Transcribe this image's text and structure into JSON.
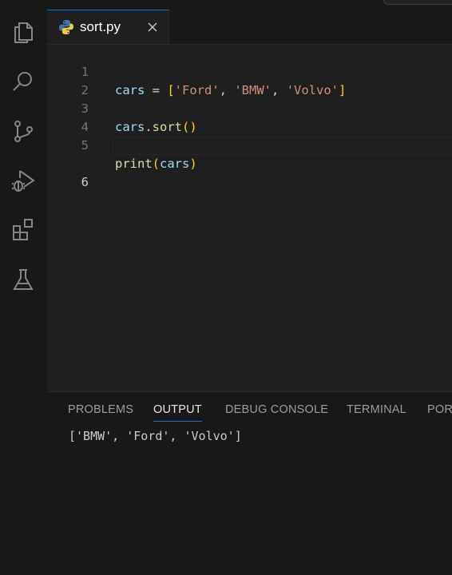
{
  "tab": {
    "filename": "sort.py"
  },
  "editor": {
    "lines": [
      {
        "number": "1",
        "tokens": [
          "cars",
          " = ",
          "[",
          "'Ford'",
          ", ",
          "'BMW'",
          ", ",
          "'Volvo'",
          "]"
        ]
      },
      {
        "number": "2",
        "tokens": []
      },
      {
        "number": "3",
        "tokens": [
          "cars",
          ".",
          "sort",
          "()"
        ]
      },
      {
        "number": "4",
        "tokens": []
      },
      {
        "number": "5",
        "tokens": [
          "print",
          "(",
          "cars",
          ")"
        ]
      },
      {
        "number": "6",
        "tokens": []
      }
    ],
    "active_line": "6"
  },
  "panel": {
    "tabs": [
      "PROBLEMS",
      "OUTPUT",
      "DEBUG CONSOLE",
      "TERMINAL",
      "PORTS"
    ],
    "active_tab": "OUTPUT",
    "output_text": "['BMW', 'Ford', 'Volvo']"
  },
  "activity_bar": {
    "icons": [
      "explorer-icon",
      "search-icon",
      "source-control-icon",
      "run-debug-icon",
      "extensions-icon",
      "testing-icon"
    ]
  },
  "colors": {
    "accent": "#0078d4",
    "string": "#ce9178",
    "variable": "#9cdcfe",
    "function": "#dcdcaa",
    "bracket": "#ffd700"
  }
}
